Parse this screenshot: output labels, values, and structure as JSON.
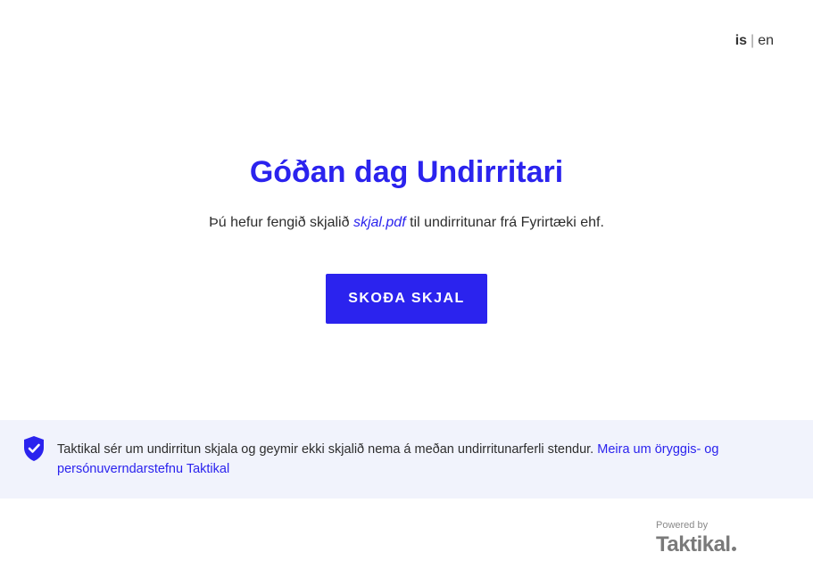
{
  "language": {
    "active": "is",
    "separator": "|",
    "other": "en"
  },
  "main": {
    "greeting": "Góðan dag Undirritari",
    "message_before": "Þú hefur fengið skjalið ",
    "document_name": "skjal.pdf",
    "message_after": " til undirritunar frá Fyrirtæki ehf.",
    "view_button_label": "SKOÐA SKJAL"
  },
  "security": {
    "icon": "shield-check-icon",
    "text": "Taktikal sér um undirritun skjala og geymir ekki skjalið nema á meðan undirritunarferli stendur. ",
    "link_text": "Meira um öryggis- og persónuverndarstefnu Taktikal"
  },
  "footer": {
    "powered_by": "Powered by",
    "brand": "Taktikal"
  },
  "colors": {
    "accent": "#2b23ee",
    "security_background": "#f1f3fc",
    "text": "#2d2d2d",
    "logo_gray": "#7a7a7a"
  }
}
